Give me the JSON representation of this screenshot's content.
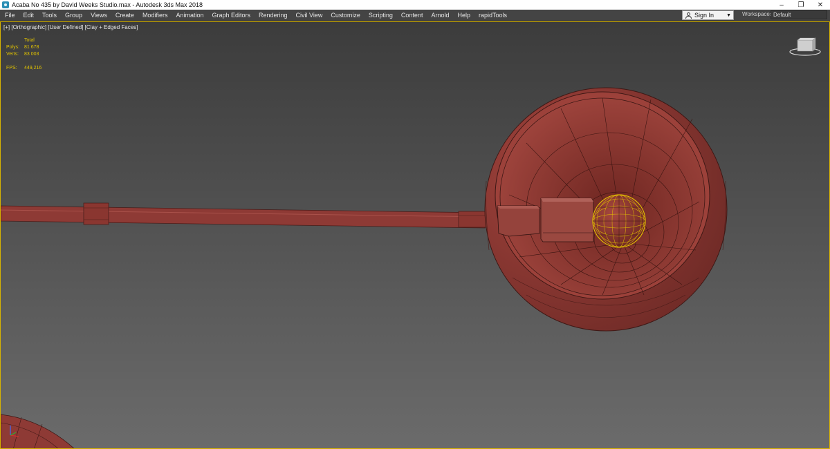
{
  "window": {
    "title": "Acaba No 435 by David Weeks Studio.max - Autodesk 3ds Max 2018",
    "controls": [
      "–",
      "❐",
      "✕"
    ]
  },
  "menubar": {
    "items": [
      "File",
      "Edit",
      "Tools",
      "Group",
      "Views",
      "Create",
      "Modifiers",
      "Animation",
      "Graph Editors",
      "Rendering",
      "Civil View",
      "Customize",
      "Scripting",
      "Content",
      "Arnold",
      "Help",
      "rapidTools"
    ],
    "signin_label": "Sign In",
    "workspaces_label": "Workspaces:",
    "workspace_value": "Default"
  },
  "viewport": {
    "label_plus": "[+]",
    "label_view": "[Orthographic]",
    "label_user": "[User Defined]",
    "label_shading": "[Clay + Edged Faces]",
    "stats": {
      "total_label": "Total",
      "polys_label": "Polys:",
      "polys_value": "81 678",
      "verts_label": "Verts:",
      "verts_value": "83 003",
      "fps_label": "FPS:",
      "fps_value": "449,216"
    }
  },
  "colors": {
    "clay": "#8e3a35",
    "selection": "#e3c100",
    "viewport_border": "#d8b400"
  }
}
